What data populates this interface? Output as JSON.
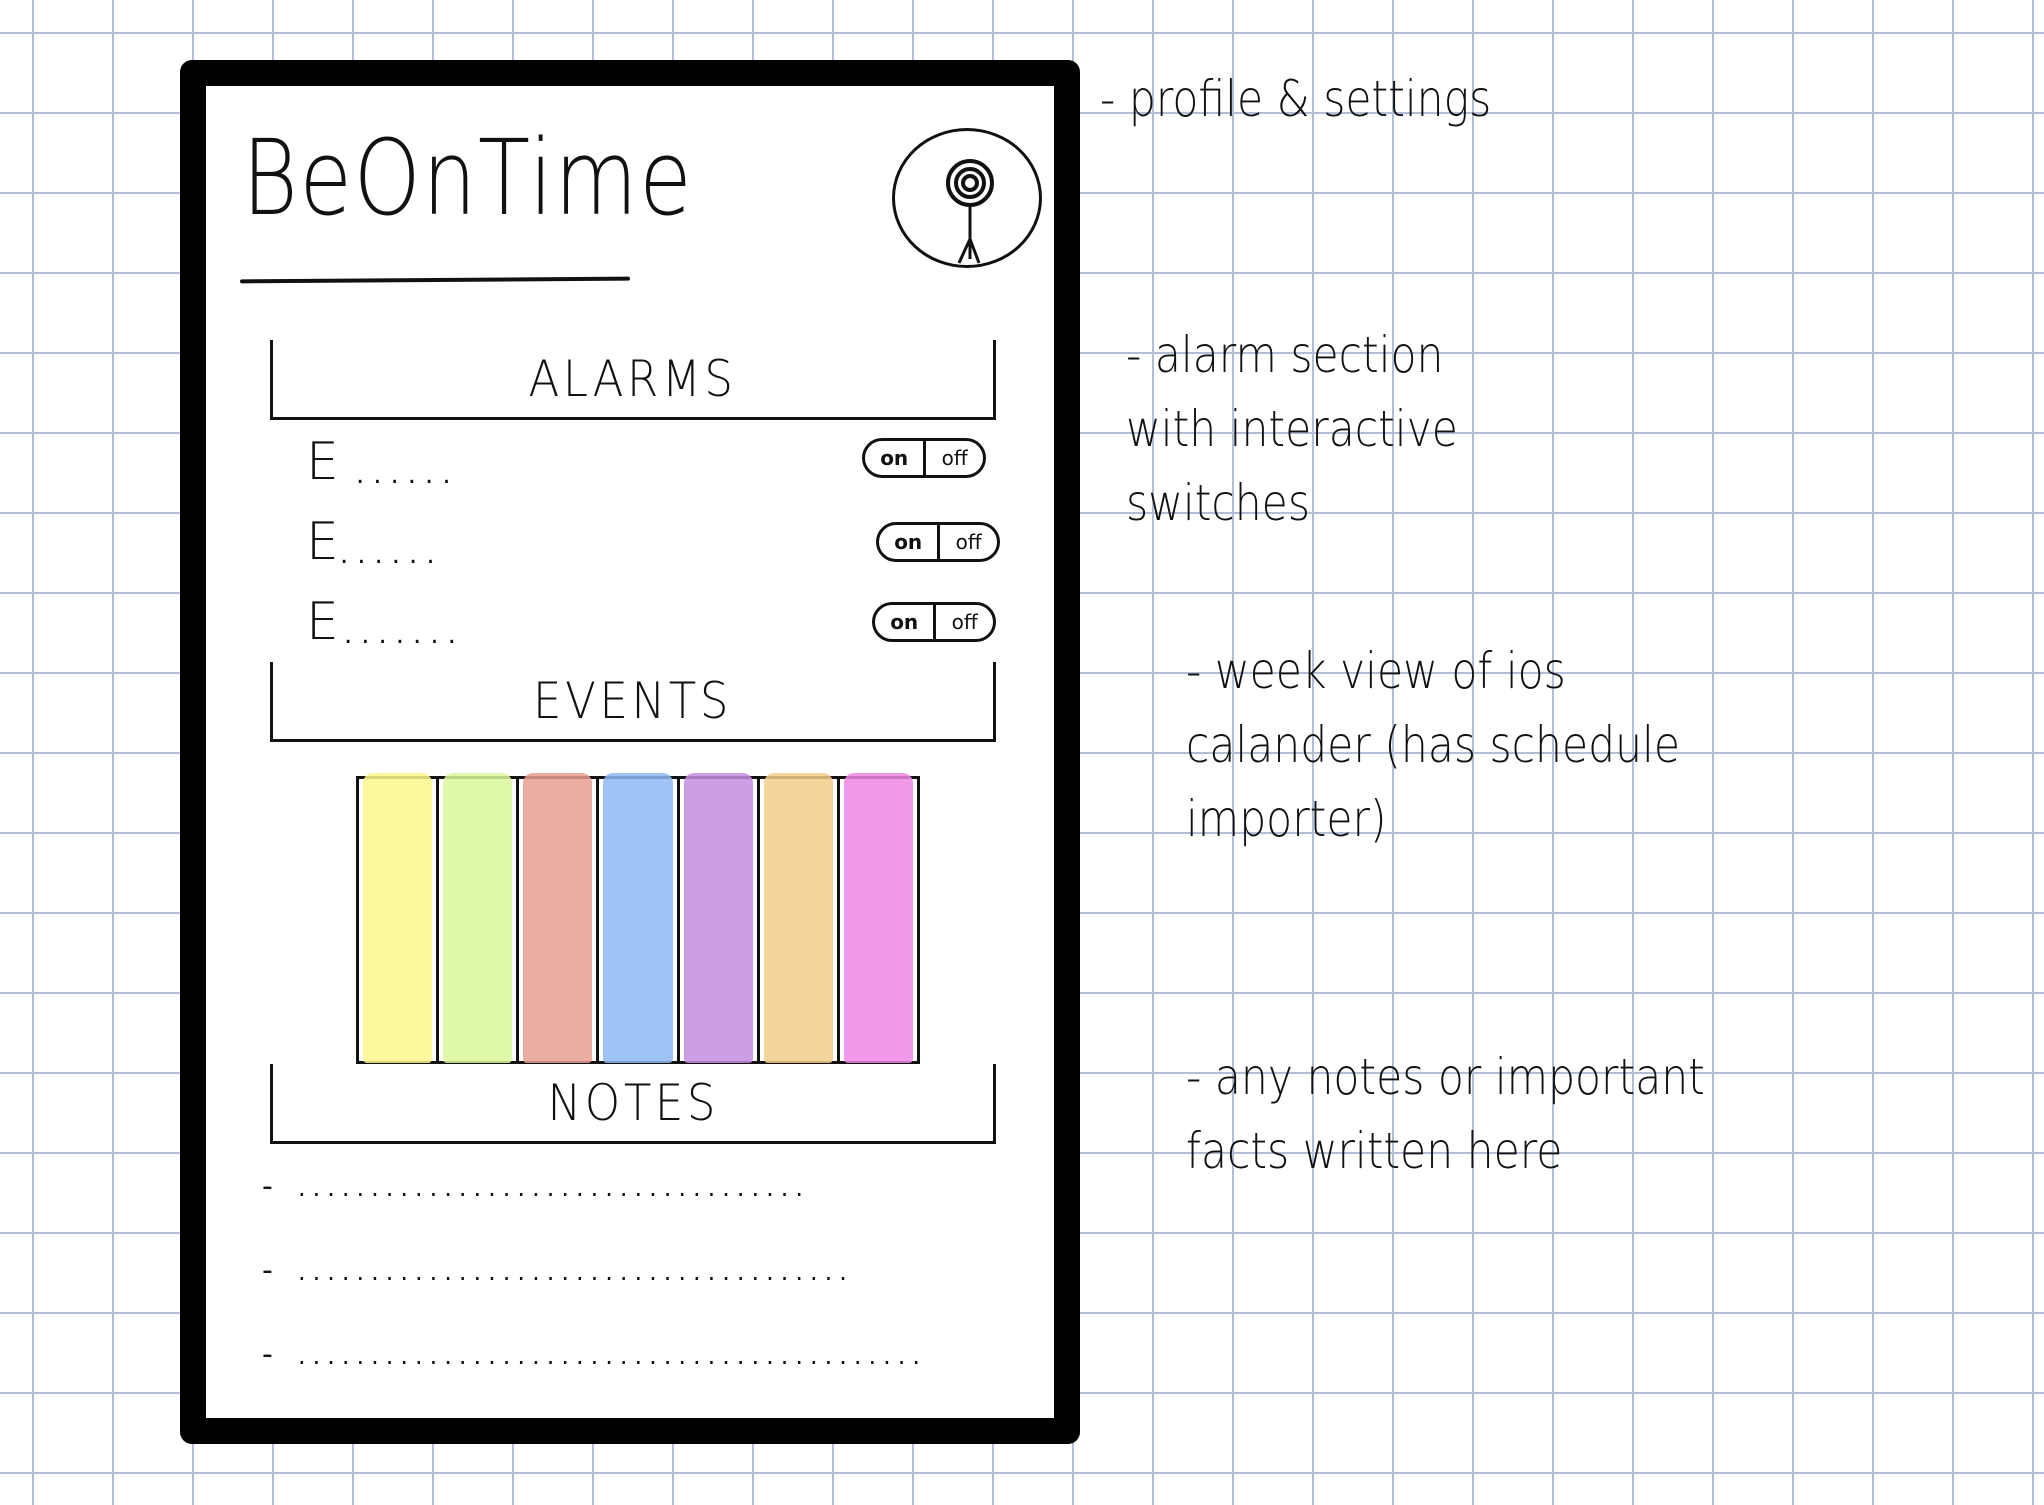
{
  "app": {
    "title": "BeOnTime"
  },
  "profile": {
    "icon": "profile-avatar-icon"
  },
  "sections": {
    "alarms": "ALARMS",
    "events": "EVENTS",
    "notes": "NOTES"
  },
  "alarms": [
    {
      "label": "E",
      "placeholder": "......",
      "toggle_on": "on",
      "toggle_off": "off"
    },
    {
      "label": "E",
      "placeholder": "......",
      "toggle_on": "on",
      "toggle_off": "off"
    },
    {
      "label": "E",
      "placeholder": ".......",
      "toggle_on": "on",
      "toggle_off": "off"
    }
  ],
  "calendar": {
    "colors": [
      "#fbf78a",
      "#d9f79b",
      "#e89f90",
      "#8fb8f4",
      "#c48ce0",
      "#f2cf8c",
      "#ee86e4"
    ]
  },
  "notes": [
    {
      "bullet": "-",
      "placeholder": "..................................."
    },
    {
      "bullet": "-",
      "placeholder": "......................................"
    },
    {
      "bullet": "-",
      "placeholder": "..........................................."
    }
  ],
  "annotations": {
    "profile": "- profile & settings",
    "alarms": "- alarm section\n  with interactive\n  switches",
    "events": "- week view of ios\n  calander (has schedule\n            importer)",
    "notes": "- any notes or important\n  facts written here"
  }
}
